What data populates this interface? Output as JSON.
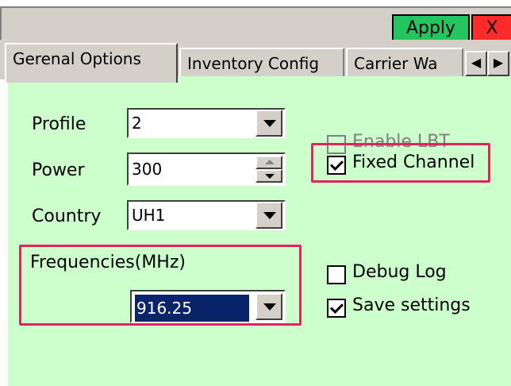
{
  "toolbar": {
    "apply_label": "Apply",
    "close_label": "X"
  },
  "tabs": [
    {
      "label": "Gerenal Options",
      "active": true
    },
    {
      "label": "Inventory Config",
      "active": false
    },
    {
      "label": "Carrier Wa",
      "active": false
    }
  ],
  "tab_scroll": {
    "left": "◀",
    "right": "▶"
  },
  "form": {
    "profile": {
      "label": "Profile",
      "value": "2"
    },
    "power": {
      "label": "Power",
      "value": "300"
    },
    "country": {
      "label": "Country",
      "value": "UH1"
    },
    "frequencies": {
      "label": "Frequencies(MHz)",
      "value": "916.25"
    }
  },
  "checkboxes": {
    "enable_lbt": {
      "label": "Enable LBT",
      "checked": false,
      "enabled": false
    },
    "fixed_channel": {
      "label": "Fixed Channel",
      "checked": true
    },
    "debug_log": {
      "label": "Debug Log",
      "checked": false
    },
    "save_settings": {
      "label": "Save settings",
      "checked": true
    }
  },
  "colors": {
    "panel_bg": "#ccffcc",
    "apply_bg": "#22c55e",
    "close_bg": "#ff2b2b",
    "highlight": "#e0245e",
    "selection": "#0a246a"
  }
}
